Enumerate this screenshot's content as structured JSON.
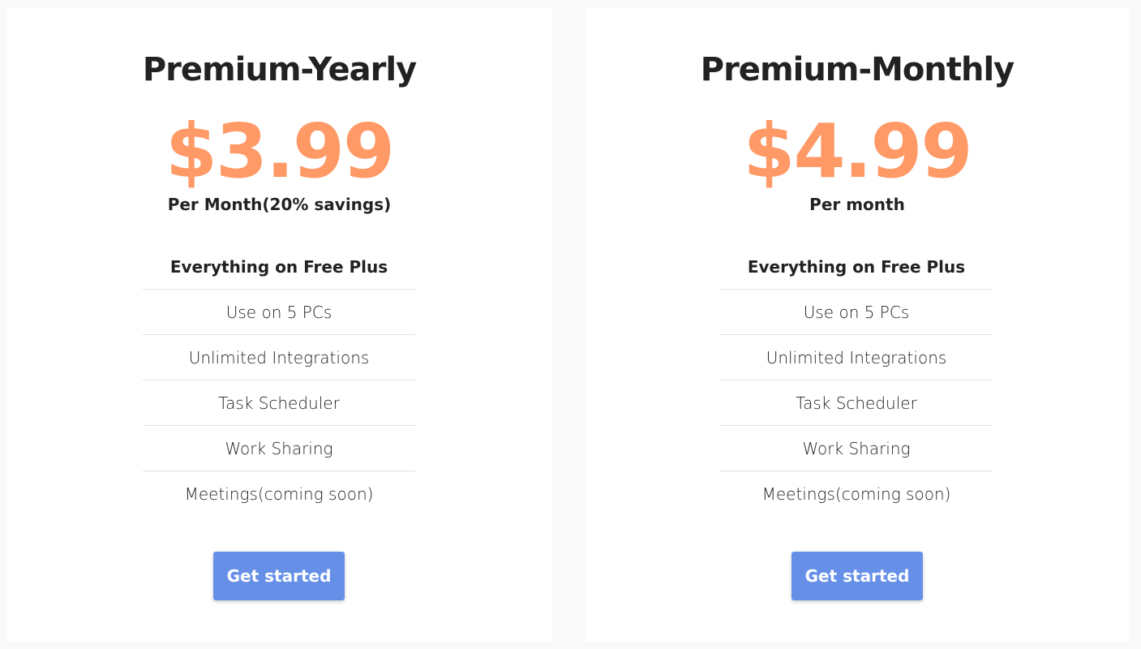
{
  "colors": {
    "accent_price": "#ff9966",
    "button": "#6690e8",
    "background": "#f9f9f9"
  },
  "plans": [
    {
      "title": "Premium-Yearly",
      "price": "$3.99",
      "period": "Per Month(20% savings)",
      "features": [
        "Everything on Free Plus",
        "Use on 5 PCs",
        "Unlimited Integrations",
        "Task Scheduler",
        "Work Sharing",
        "Meetings(coming soon)"
      ],
      "cta": "Get started"
    },
    {
      "title": "Premium-Monthly",
      "price": "$4.99",
      "period": "Per month",
      "features": [
        "Everything on Free Plus",
        "Use on 5 PCs",
        "Unlimited Integrations",
        "Task Scheduler",
        "Work Sharing",
        "Meetings(coming soon)"
      ],
      "cta": "Get started"
    }
  ]
}
